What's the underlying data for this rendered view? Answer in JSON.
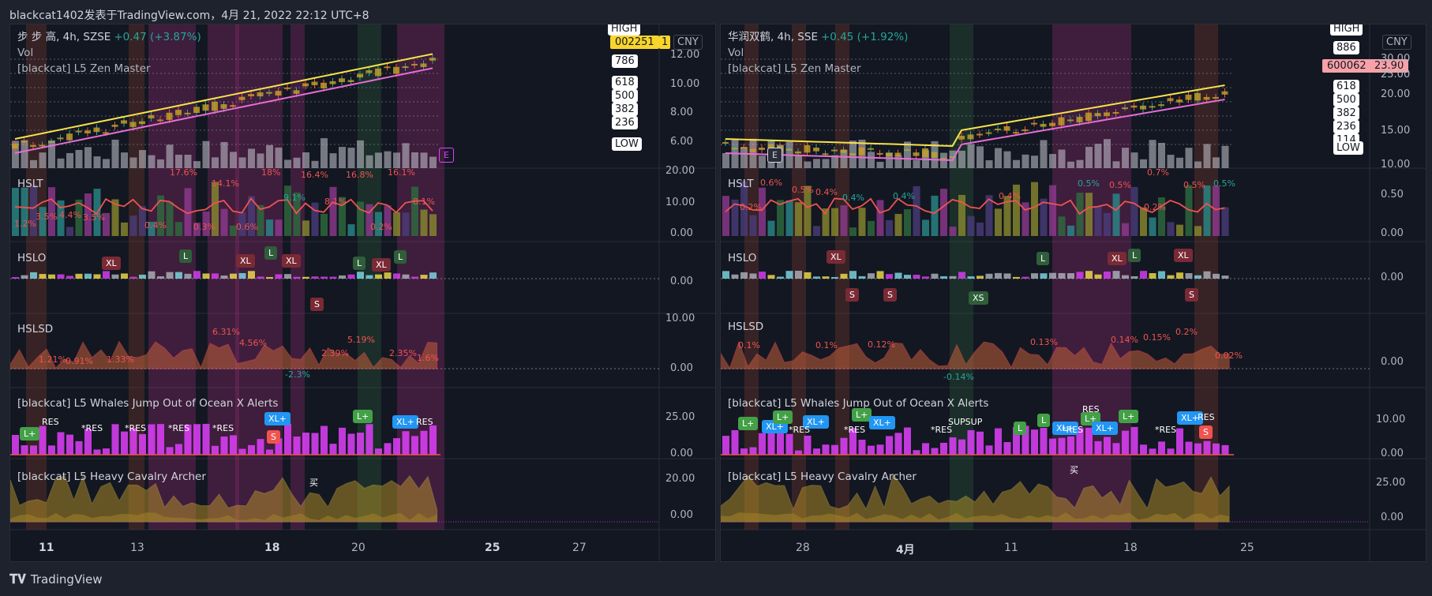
{
  "header": {
    "title": "blackcat1402发表于TradingView.com，4月 21, 2022 22:12 UTC+8"
  },
  "footer": {
    "brand": "TradingView"
  },
  "charts": [
    {
      "legend": {
        "symbol": "步 步 高, 4h, SZSE",
        "change": "+0.47 (+3.87%)",
        "vol": "Vol",
        "study": "[blackcat] L5 Zen Master"
      },
      "currency": "CNY",
      "price_label": {
        "ticker": "002251",
        "value": "1"
      },
      "top_tag": "HIGH",
      "fib_tags": [
        "786",
        "618",
        "500",
        "382",
        "236",
        "LOW"
      ],
      "price_ticks": [
        "12.00",
        "10.00",
        "8.00",
        "6.00"
      ],
      "e_marker": "E",
      "panes": [
        {
          "label": "HSLT",
          "ticks": [
            "20.00",
            "10.00",
            "0.00"
          ]
        },
        {
          "label": "HSLO",
          "ticks": [
            "0.00"
          ]
        },
        {
          "label": "HSLSD",
          "ticks": [
            "10.00",
            "0.00"
          ]
        },
        {
          "label": "[blackcat] L5 Whales Jump Out of Ocean X Alerts",
          "ticks": [
            "25.00",
            "0.00"
          ]
        },
        {
          "label": "[blackcat] L5 Heavy Cavalry Archer",
          "ticks": [
            "20.00",
            "0.00"
          ]
        }
      ],
      "hslt_labels": [
        "17.6%",
        "18%",
        "16.4%",
        "16.8%",
        "16.1%",
        "14.1%",
        "9.1%",
        "8.1%",
        "8.1%",
        "1.2%",
        "3.5%",
        "4.4%",
        "3.5%",
        "0.3%",
        "0.6%",
        "0.2%",
        "0.4%"
      ],
      "hslo_badges": [
        "XL",
        "L",
        "XL",
        "L",
        "XL",
        "L",
        "XL",
        "L",
        "S"
      ],
      "hslsd_labels": [
        "6.31%",
        "5.19%",
        "4.56%",
        "2.39%",
        "2.35%",
        "1.21%",
        "0.91%",
        "1.33%",
        "1.6%",
        "-2.3%"
      ],
      "whale_badges": [
        "L+",
        "XL+",
        "L+",
        "XL+",
        "S"
      ],
      "whale_texts": [
        "RES",
        "*RES",
        "*RES",
        "*RES",
        "*RES",
        "RES"
      ],
      "archer_text": "买",
      "x_labels": [
        "11",
        "13",
        "18",
        "20",
        "25",
        "27"
      ]
    },
    {
      "legend": {
        "symbol": "华润双鹤, 4h, SSE",
        "change": "+0.45 (+1.92%)",
        "vol": "Vol",
        "study": "[blackcat] L5 Zen Master"
      },
      "currency": "CNY",
      "price_label": {
        "ticker": "600062",
        "value": "23.90"
      },
      "top_tag": "HIGH",
      "fib_tags": [
        "886",
        "618",
        "500",
        "382",
        "236",
        "114",
        "LOW"
      ],
      "price_ticks": [
        "30.00",
        "25.00",
        "20.00",
        "15.00",
        "10.00"
      ],
      "e_marker": "E",
      "panes": [
        {
          "label": "HSLT",
          "ticks": [
            "0.50",
            "0.00"
          ]
        },
        {
          "label": "HSLO",
          "ticks": [
            "0.00"
          ]
        },
        {
          "label": "HSLSD",
          "ticks": [
            "0.00"
          ]
        },
        {
          "label": "[blackcat] L5 Whales Jump Out of Ocean X Alerts",
          "ticks": [
            "10.00",
            "0.00"
          ]
        },
        {
          "label": "[blackcat] L5 Heavy Cavalry Archer",
          "ticks": [
            "25.00",
            "0.00"
          ]
        }
      ],
      "hslt_labels": [
        "0.6%",
        "0.5%",
        "0.4%",
        "0.4%",
        "0.4%",
        "0.4%",
        "0.5%",
        "0.5%",
        "0.5%",
        "0.5%",
        "0.2%",
        "0.2%",
        "0.7%"
      ],
      "hslo_badges": [
        "XL",
        "L",
        "XL",
        "L",
        "XL",
        "S",
        "S",
        "XS",
        "S"
      ],
      "hslsd_labels": [
        "0.1%",
        "0.1%",
        "0.12%",
        "0.13%",
        "0.14%",
        "0.15%",
        "0.2%",
        "0.02%",
        "-0.14%"
      ],
      "whale_badges": [
        "L+",
        "XL+",
        "L+",
        "XL+",
        "L+",
        "XL+",
        "L",
        "L",
        "XL+",
        "L+",
        "XL+",
        "L+",
        "XL+",
        "S"
      ],
      "whale_texts": [
        "*RES",
        "*RES",
        "*RES",
        "SUPSUP",
        "*RES",
        "RES",
        "*RES",
        "RES"
      ],
      "archer_text": "买",
      "x_labels": [
        "28",
        "4月",
        "11",
        "18",
        "25"
      ]
    }
  ]
}
